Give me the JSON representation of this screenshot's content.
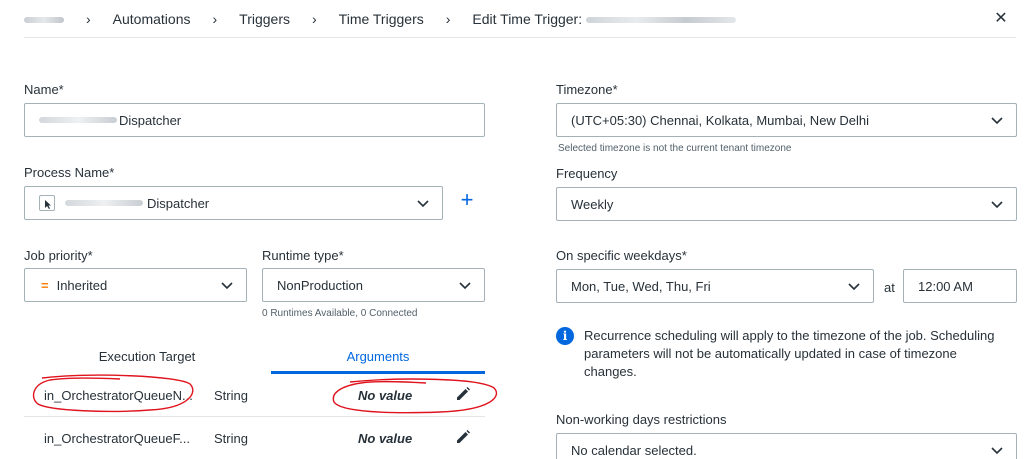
{
  "breadcrumb": {
    "items": [
      "Automations",
      "Triggers",
      "Time Triggers"
    ],
    "current_prefix": "Edit Time Trigger:"
  },
  "form": {
    "name": {
      "label": "Name*",
      "value_suffix": "Dispatcher"
    },
    "process_name": {
      "label": "Process Name*",
      "value_suffix": "Dispatcher"
    },
    "job_priority": {
      "label": "Job priority*",
      "value": "Inherited",
      "icon": "equals-priority-icon"
    },
    "runtime_type": {
      "label": "Runtime type*",
      "value": "NonProduction",
      "helper": "0 Runtimes Available, 0 Connected"
    },
    "timezone": {
      "label": "Timezone*",
      "value": "(UTC+05:30) Chennai, Kolkata, Mumbai, New Delhi",
      "helper": "Selected timezone is not the current tenant timezone"
    },
    "frequency": {
      "label": "Frequency",
      "value": "Weekly"
    },
    "weekdays": {
      "label": "On specific weekdays*",
      "value": "Mon, Tue, Wed, Thu, Fri",
      "at_label": "at",
      "time": "12:00 AM"
    },
    "info": "Recurrence scheduling will apply to the timezone of the job. Scheduling parameters will not be automatically updated in case of timezone changes.",
    "non_working": {
      "label": "Non-working days restrictions",
      "value": "No calendar selected."
    }
  },
  "tabs": [
    {
      "label": "Execution Target",
      "active": false
    },
    {
      "label": "Arguments",
      "active": true
    }
  ],
  "arguments": [
    {
      "name": "in_OrchestratorQueueN...",
      "type": "String",
      "value": "No value"
    },
    {
      "name": "in_OrchestratorQueueF...",
      "type": "String",
      "value": "No value"
    }
  ],
  "colors": {
    "accent": "#0067df",
    "priority": "#fa7b00",
    "annotation": "#e0141e"
  }
}
